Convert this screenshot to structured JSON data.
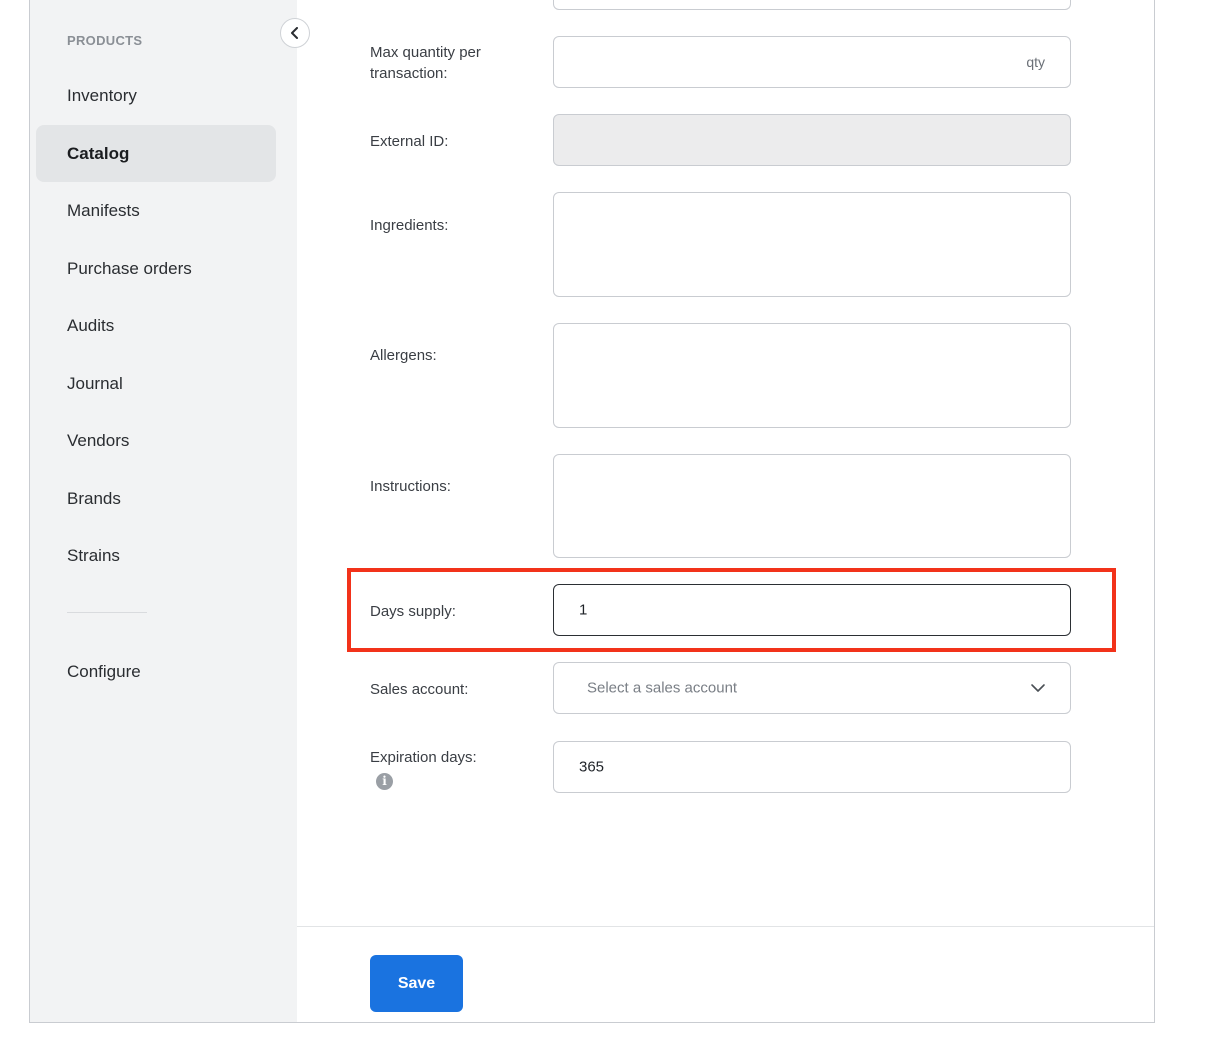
{
  "sidebar": {
    "section_title": "PRODUCTS",
    "items": [
      {
        "label": "Inventory"
      },
      {
        "label": "Catalog",
        "active": true
      },
      {
        "label": "Manifests"
      },
      {
        "label": "Purchase orders"
      },
      {
        "label": "Audits"
      },
      {
        "label": "Journal"
      },
      {
        "label": "Vendors"
      },
      {
        "label": "Brands"
      },
      {
        "label": "Strains"
      }
    ],
    "configure_label": "Configure",
    "collapse_icon": "chevron-left-icon"
  },
  "form": {
    "max_qty": {
      "label": "Max quantity per transaction:",
      "value": "",
      "suffix": "qty"
    },
    "external_id": {
      "label": "External ID:",
      "value": "",
      "disabled": true
    },
    "ingredients": {
      "label": "Ingredients:",
      "value": ""
    },
    "allergens": {
      "label": "Allergens:",
      "value": ""
    },
    "instructions": {
      "label": "Instructions:",
      "value": ""
    },
    "days_supply": {
      "label": "Days supply:",
      "value": "1"
    },
    "sales_account": {
      "label": "Sales account:",
      "placeholder": "Select a sales account",
      "icon": "chevron-down-icon"
    },
    "expiration_days": {
      "label": "Expiration days:",
      "value": "365",
      "icon": "info-icon"
    }
  },
  "footer": {
    "save_label": "Save"
  },
  "colors": {
    "accent": "#1a73e0",
    "highlight": "#f2321a",
    "sidebar_bg": "#f2f3f4"
  }
}
